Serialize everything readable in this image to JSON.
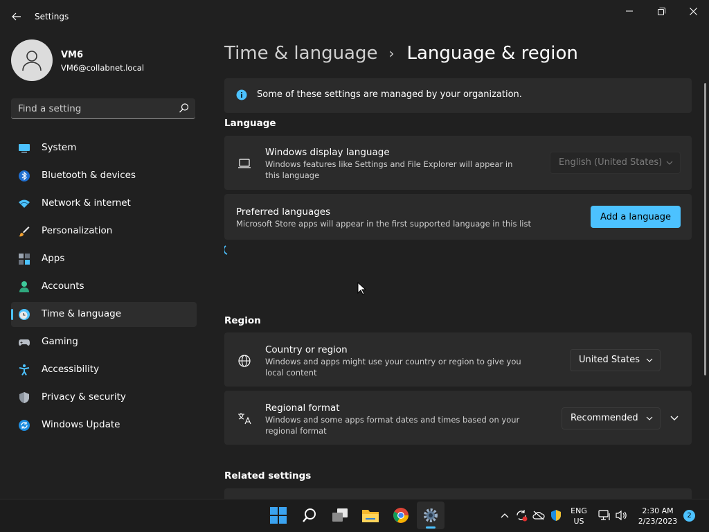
{
  "window": {
    "title": "Settings"
  },
  "user": {
    "name": "VM6",
    "email": "VM6@collabnet.local"
  },
  "search": {
    "placeholder": "Find a setting"
  },
  "sidebar": {
    "items": [
      {
        "label": "System",
        "icon": "system-icon"
      },
      {
        "label": "Bluetooth & devices",
        "icon": "bluetooth-icon"
      },
      {
        "label": "Network & internet",
        "icon": "network-icon"
      },
      {
        "label": "Personalization",
        "icon": "brush-icon"
      },
      {
        "label": "Apps",
        "icon": "apps-icon"
      },
      {
        "label": "Accounts",
        "icon": "accounts-icon"
      },
      {
        "label": "Time & language",
        "icon": "clock-globe-icon",
        "selected": true
      },
      {
        "label": "Gaming",
        "icon": "gamepad-icon"
      },
      {
        "label": "Accessibility",
        "icon": "accessibility-icon"
      },
      {
        "label": "Privacy & security",
        "icon": "shield-icon"
      },
      {
        "label": "Windows Update",
        "icon": "update-icon"
      }
    ]
  },
  "breadcrumb": {
    "parent": "Time & language",
    "separator": "›",
    "current": "Language & region"
  },
  "banner": {
    "text": "Some of these settings are managed by your organization."
  },
  "language": {
    "section_title": "Language",
    "display": {
      "title": "Windows display language",
      "description": "Windows features like Settings and File Explorer will appear in this language",
      "value": "English (United States)"
    },
    "preferred": {
      "title": "Preferred languages",
      "description": "Microsoft Store apps will appear in the first supported language in this list",
      "button_label": "Add a language"
    }
  },
  "region": {
    "section_title": "Region",
    "country": {
      "title": "Country or region",
      "description": "Windows and apps might use your country or region to give you local content",
      "value": "United States"
    },
    "format": {
      "title": "Regional format",
      "description": "Windows and some apps format dates and times based on your regional format",
      "value": "Recommended"
    }
  },
  "related": {
    "section_title": "Related settings"
  },
  "taskbar": {
    "lang_line1": "ENG",
    "lang_line2": "US",
    "time": "2:30 AM",
    "date": "2/23/2023",
    "notification_count": "2"
  },
  "colors": {
    "accent": "#4cc2ff",
    "background": "#202020",
    "card": "#2b2b2b"
  }
}
